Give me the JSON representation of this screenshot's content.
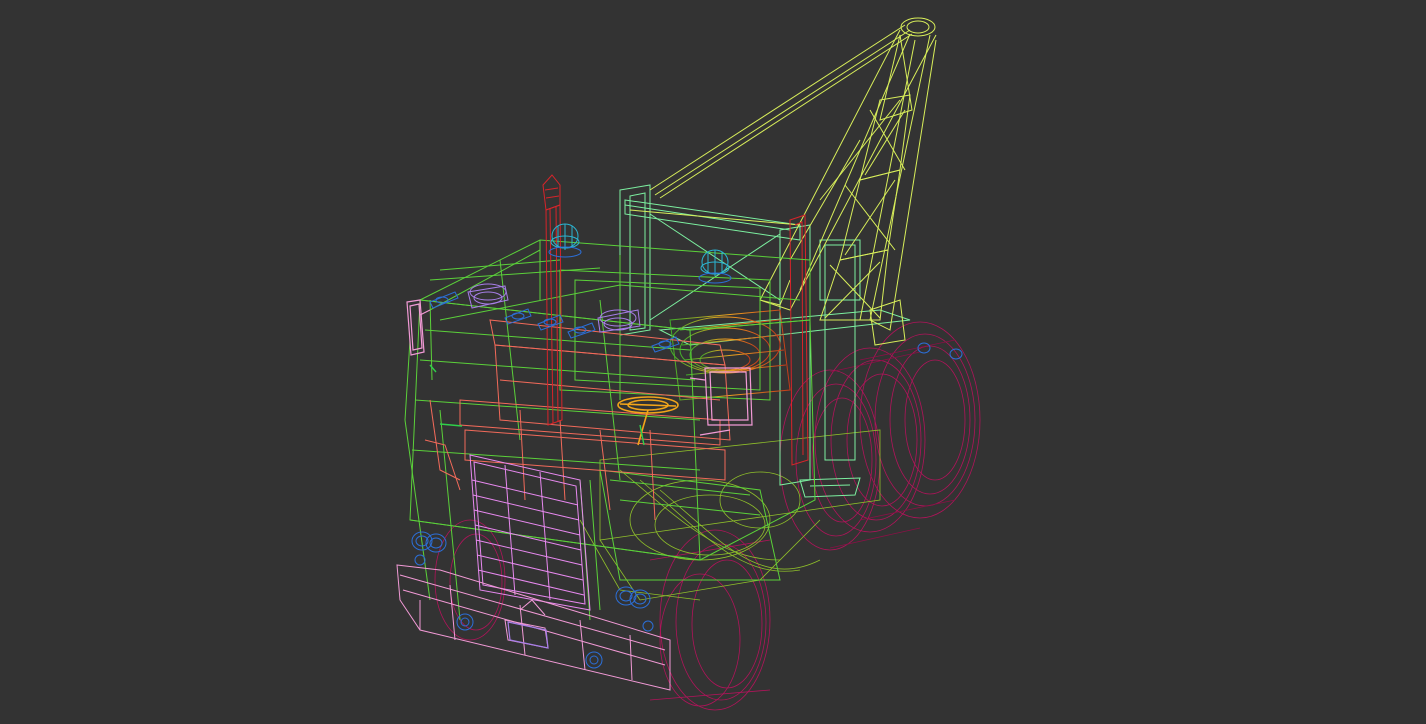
{
  "viewport": {
    "background": "#333333",
    "render_mode": "wireframe",
    "model": "crane-tow-truck"
  },
  "colors": {
    "cab": "#5bd13a",
    "cab_dark": "#3fae2a",
    "crane": "#d8ee5a",
    "crane_frame": "#7cf0a0",
    "wheels": "#b0145a",
    "bumper": "#f29ad6",
    "grille": "#e889f0",
    "interior": "#f26a5a",
    "exhaust": "#d8242a",
    "lights": "#2c6fd8",
    "beacon": "#2bb3d0",
    "horn": "#a77ee8",
    "steering": "#f2a51a",
    "body_orange": "#f0a020"
  },
  "parts": [
    "cab",
    "crane-boom",
    "crane-frame",
    "winch-drum",
    "exhaust-stack",
    "beacon-light",
    "roof-lights",
    "air-horns",
    "steering-wheel",
    "mirrors",
    "radiator-grille",
    "front-bumper",
    "headlights",
    "wheels",
    "chassis"
  ]
}
